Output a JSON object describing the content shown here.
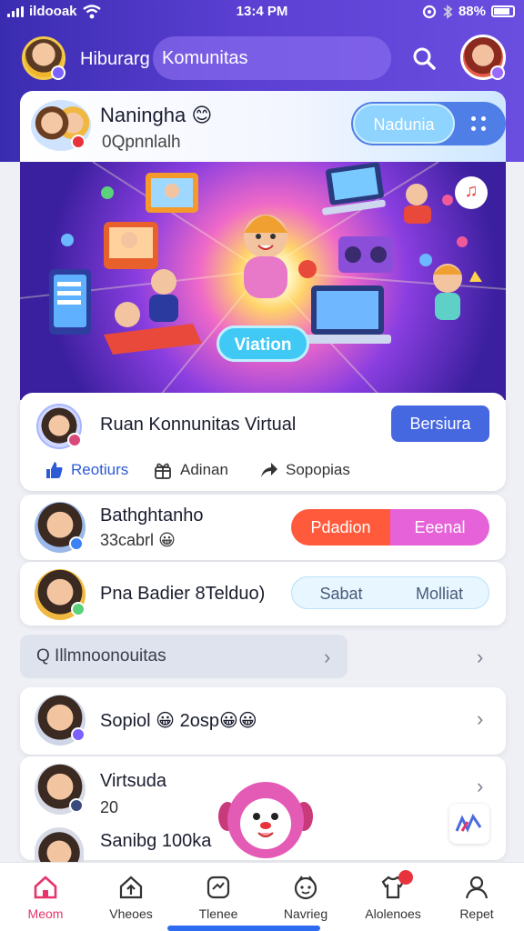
{
  "status_bar": {
    "carrier": "ildooak",
    "time": "13:4 PM",
    "battery": "88%"
  },
  "app_bar": {
    "title": "Hiburarg",
    "search_text": "Komunitas"
  },
  "greeting": {
    "name": "Naningha",
    "subtitle": "0Qpnnlalh",
    "toggle_label": "Nadunia"
  },
  "hero": {
    "button_label": "Viation"
  },
  "community": {
    "title": "Ruan Konnunitas Virtual",
    "join_label": "Bersiura",
    "actions": [
      {
        "label": "Reotiurs",
        "icon": "like-icon"
      },
      {
        "label": "Adinan",
        "icon": "gift-icon"
      },
      {
        "label": "Sopopias",
        "icon": "share-icon"
      }
    ]
  },
  "rows": [
    {
      "title": "Bathghtanho",
      "subtitle": "33cabrl",
      "btn_left": "Pdadion",
      "btn_right": "Eeenal"
    },
    {
      "title": "Pna Badier 8Telduo)",
      "btn_left": "Sabat",
      "btn_right": "Molliat"
    }
  ],
  "search": {
    "label": "Q Illmnoonouitas"
  },
  "list": [
    {
      "title": "Sopiol",
      "subtitle": "2osp"
    },
    {
      "title": "Virtsuda",
      "subtitle": "20"
    },
    {
      "title": "Sanibg 100ka"
    }
  ],
  "nav": [
    {
      "label": "Meom",
      "icon": "home-icon",
      "active": true
    },
    {
      "label": "Vheoes",
      "icon": "house-up-icon"
    },
    {
      "label": "Tlenee",
      "icon": "game-icon"
    },
    {
      "label": "Navrieg",
      "icon": "face-icon"
    },
    {
      "label": "Alolenoes",
      "icon": "shirt-icon",
      "badge": ""
    },
    {
      "label": "Repet",
      "icon": "profile-icon"
    }
  ],
  "colors": {
    "header": "#4b36c8",
    "accent_pink": "#e8336a",
    "join_blue": "#4567e0",
    "orange": "#ff5a3c",
    "magenta": "#e562d8"
  }
}
